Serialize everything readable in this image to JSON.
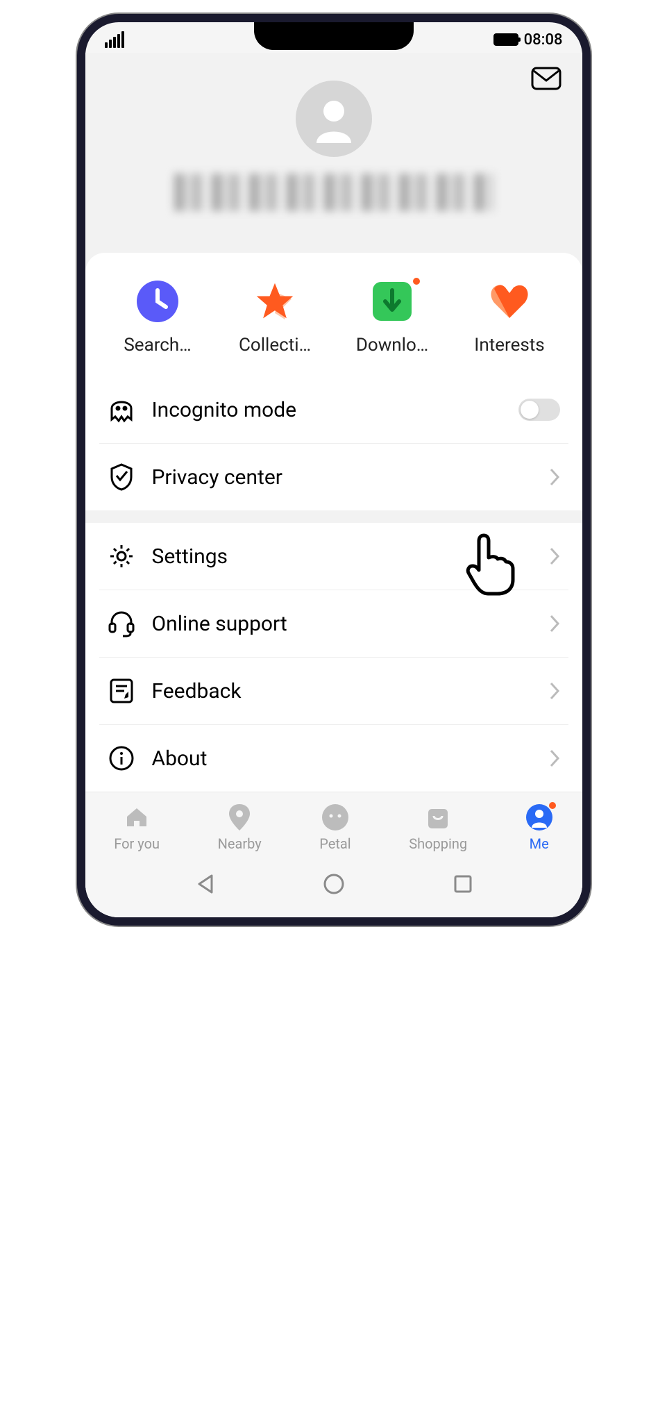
{
  "status": {
    "time": "08:08"
  },
  "quick": [
    {
      "label": "Search…",
      "icon": "clock"
    },
    {
      "label": "Collecti…",
      "icon": "star"
    },
    {
      "label": "Downlo…",
      "icon": "download",
      "badge": true
    },
    {
      "label": "Interests",
      "icon": "heart"
    }
  ],
  "rows_a": [
    {
      "label": "Incognito mode",
      "icon": "ghost",
      "control": "toggle",
      "on": false
    },
    {
      "label": "Privacy center",
      "icon": "shield",
      "control": "chevron"
    }
  ],
  "rows_b": [
    {
      "label": "Settings",
      "icon": "gear",
      "control": "chevron",
      "pointer": true
    },
    {
      "label": "Online support",
      "icon": "headset",
      "control": "chevron"
    },
    {
      "label": "Feedback",
      "icon": "note",
      "control": "chevron"
    },
    {
      "label": "About",
      "icon": "info",
      "control": "chevron"
    }
  ],
  "tabs": [
    {
      "label": "For you",
      "icon": "home"
    },
    {
      "label": "Nearby",
      "icon": "pin"
    },
    {
      "label": "Petal",
      "icon": "face"
    },
    {
      "label": "Shopping",
      "icon": "bag"
    },
    {
      "label": "Me",
      "icon": "person",
      "active": true,
      "badge": true
    }
  ]
}
